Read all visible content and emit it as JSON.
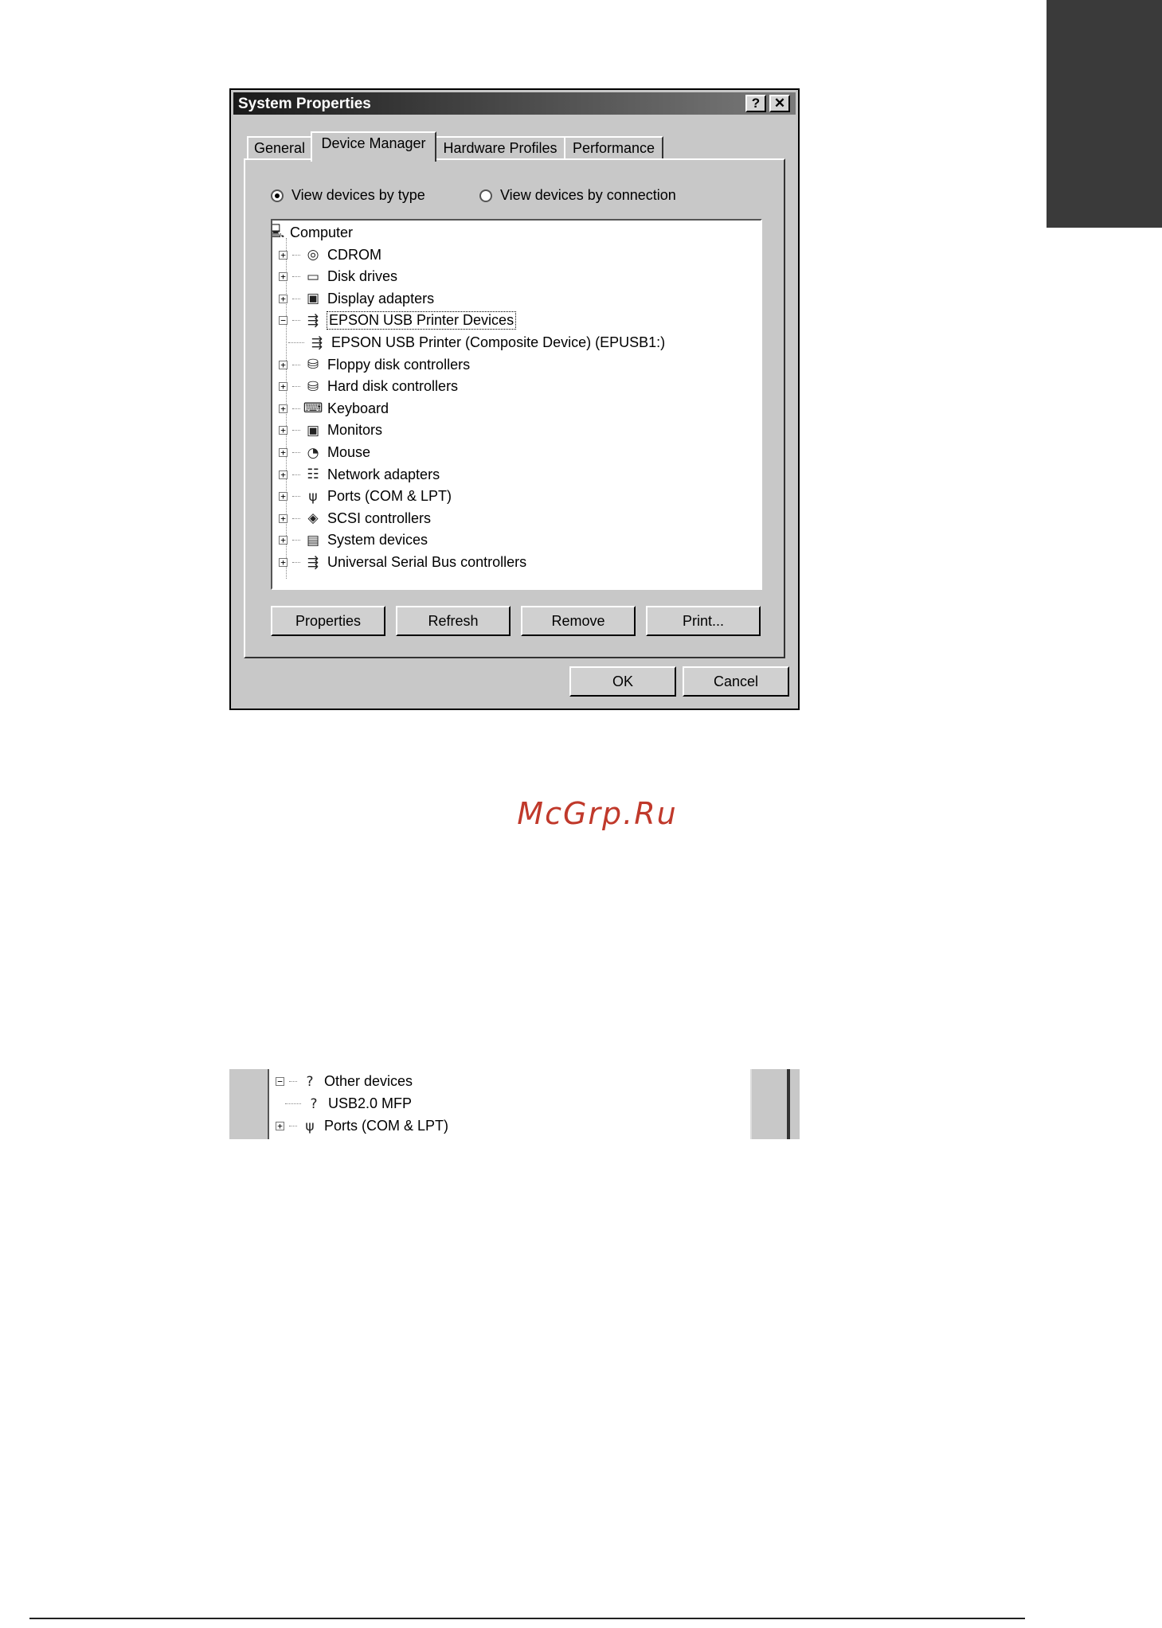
{
  "dialog": {
    "title": "System Properties",
    "help_glyph": "?",
    "close_glyph": "✕",
    "tabs": [
      {
        "label": "General"
      },
      {
        "label": "Device Manager"
      },
      {
        "label": "Hardware Profiles"
      },
      {
        "label": "Performance"
      }
    ],
    "view_by_type": "View devices by type",
    "view_by_connection": "View devices by connection",
    "tree": [
      {
        "label": "Computer",
        "icon": "computer-icon"
      },
      {
        "label": "CDROM",
        "icon": "cdrom-icon",
        "expander": "+"
      },
      {
        "label": "Disk drives",
        "icon": "disk-drive-icon",
        "expander": "+"
      },
      {
        "label": "Display adapters",
        "icon": "monitor-icon",
        "expander": "+"
      },
      {
        "label": "EPSON USB Printer Devices",
        "icon": "usb-icon",
        "expander": "−",
        "selected": true
      },
      {
        "label": "EPSON USB Printer (Composite Device) (EPUSB1:)",
        "icon": "usb-icon",
        "child": true
      },
      {
        "label": "Floppy disk controllers",
        "icon": "controller-icon",
        "expander": "+"
      },
      {
        "label": "Hard disk controllers",
        "icon": "controller-icon",
        "expander": "+"
      },
      {
        "label": "Keyboard",
        "icon": "keyboard-icon",
        "expander": "+"
      },
      {
        "label": "Monitors",
        "icon": "monitor-icon",
        "expander": "+"
      },
      {
        "label": "Mouse",
        "icon": "mouse-icon",
        "expander": "+"
      },
      {
        "label": "Network adapters",
        "icon": "network-icon",
        "expander": "+"
      },
      {
        "label": "Ports (COM & LPT)",
        "icon": "port-icon",
        "expander": "+"
      },
      {
        "label": "SCSI controllers",
        "icon": "scsi-icon",
        "expander": "+"
      },
      {
        "label": "System devices",
        "icon": "system-icon",
        "expander": "+"
      },
      {
        "label": "Universal Serial Bus controllers",
        "icon": "usb-icon",
        "expander": "+"
      }
    ],
    "buttons": {
      "properties": "Properties",
      "refresh": "Refresh",
      "remove": "Remove",
      "print": "Print...",
      "ok": "OK",
      "cancel": "Cancel"
    }
  },
  "fragment": {
    "rows": [
      {
        "label": "Other devices",
        "icon": "question-icon",
        "expander": "−"
      },
      {
        "label": "USB2.0 MFP",
        "icon": "question-icon",
        "child": true
      },
      {
        "label": "Ports (COM & LPT)",
        "icon": "port-icon",
        "expander": "+"
      }
    ]
  },
  "watermark": "McGrp.Ru"
}
